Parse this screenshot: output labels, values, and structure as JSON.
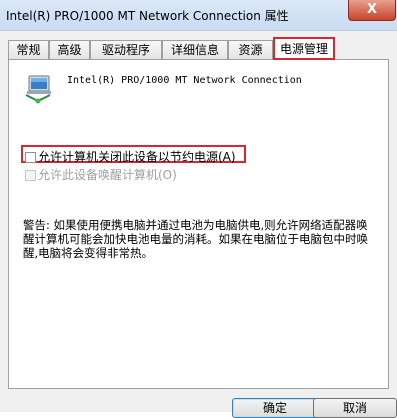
{
  "window": {
    "title": "Intel(R) PRO/1000 MT Network Connection 属性",
    "close_label": "X"
  },
  "tabs": [
    {
      "label": "常规"
    },
    {
      "label": "高级"
    },
    {
      "label": "驱动程序"
    },
    {
      "label": "详细信息"
    },
    {
      "label": "资源"
    },
    {
      "label": "电源管理",
      "active": true
    }
  ],
  "panel": {
    "adapter_name": "Intel(R) PRO/1000 MT Network Connection",
    "icon": "network-adapter-icon",
    "options": [
      {
        "label": "允许计算机关闭此设备以节约电源(A)",
        "checked": false,
        "enabled": true,
        "highlighted": true
      },
      {
        "label": "允许此设备唤醒计算机(O)",
        "checked": false,
        "enabled": false
      }
    ],
    "warning": "警告: 如果使用便携电脑并通过电池为电脑供电,则允许网络适配器唤醒计算机可能会加快电池电量的消耗。如果在电脑位于电脑包中时唤醒,电脑将会变得非常热。"
  },
  "buttons": {
    "ok_label": "确定",
    "cancel_label": "取消"
  },
  "colors": {
    "highlight": "#d9272e",
    "titlebar": "#c9dcf2"
  }
}
